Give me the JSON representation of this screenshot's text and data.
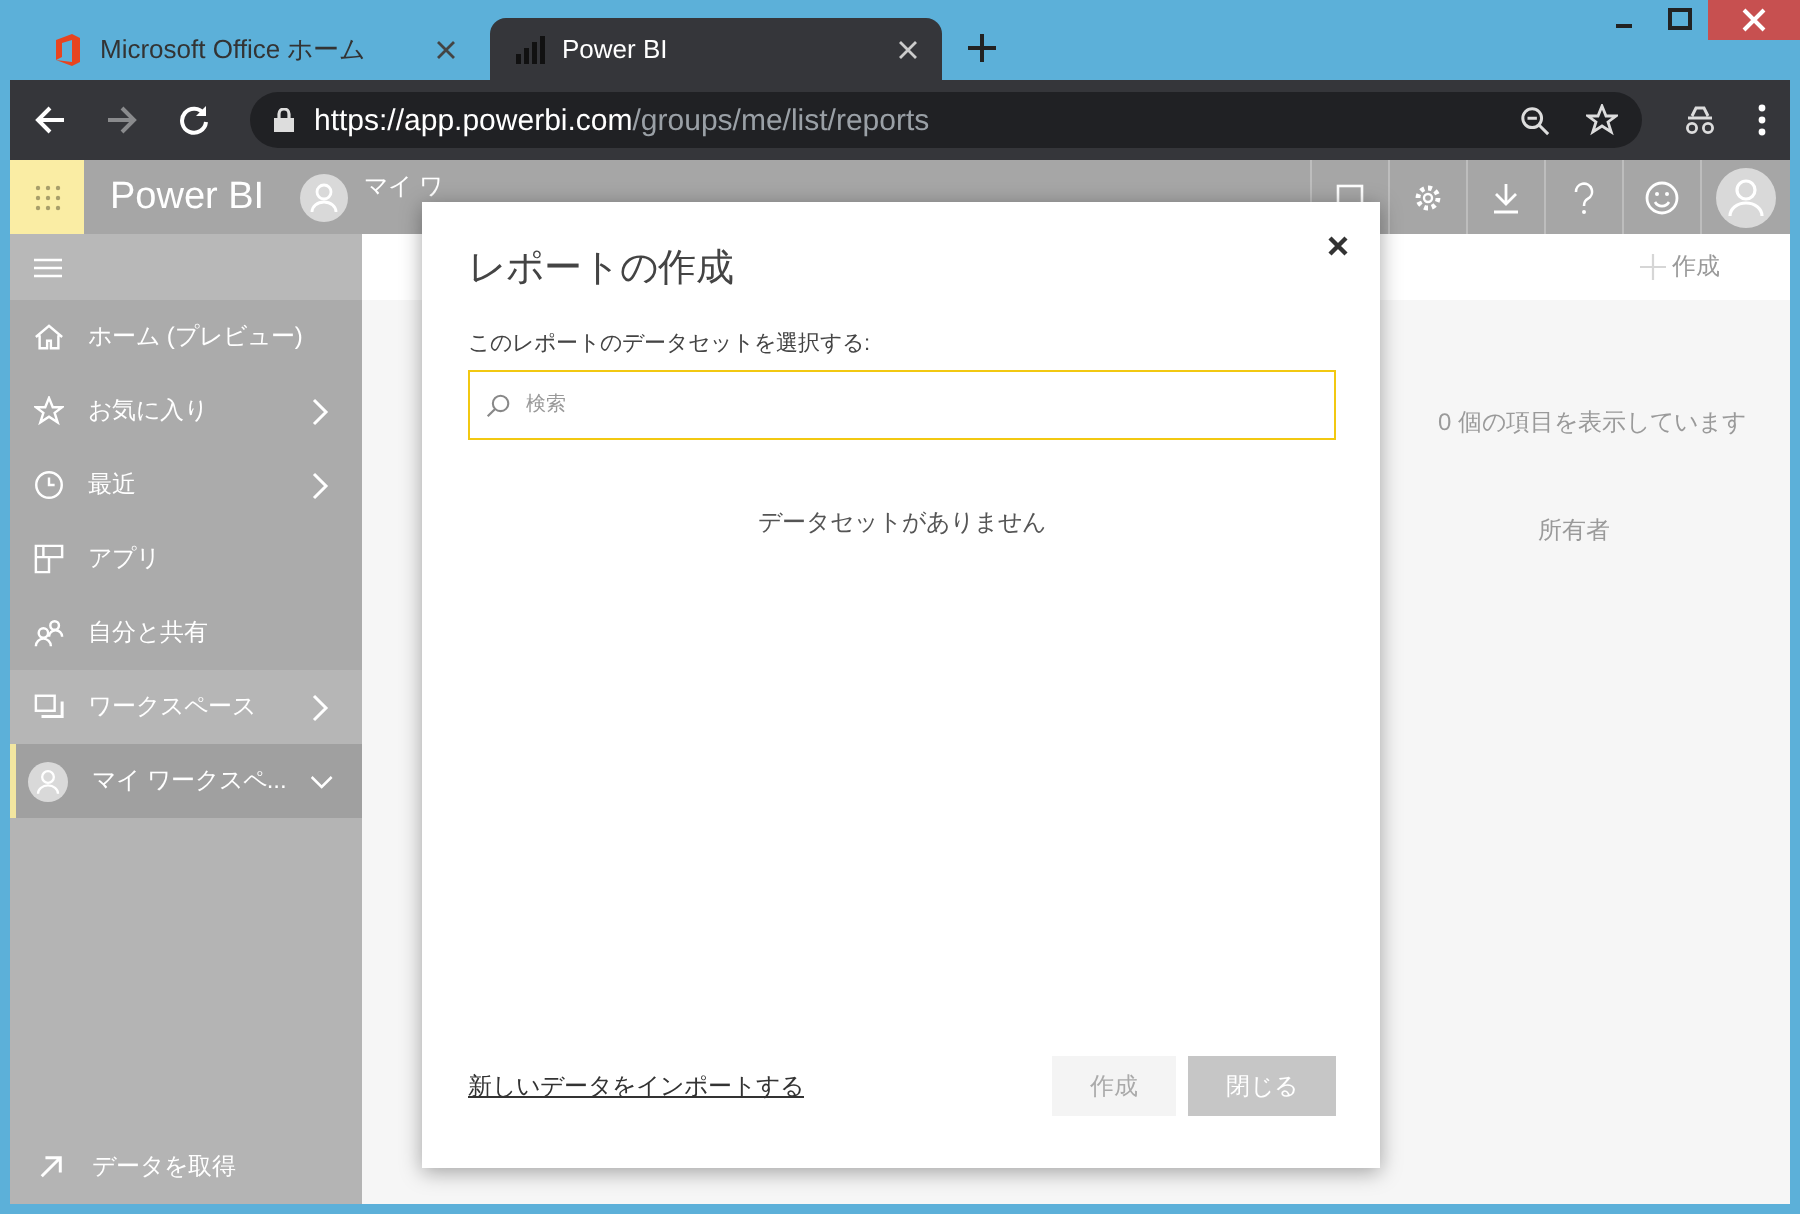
{
  "browser": {
    "tabs": [
      {
        "title": "Microsoft Office ホーム",
        "selected": false
      },
      {
        "title": "Power BI",
        "selected": true
      }
    ],
    "url": {
      "host": "https://app.powerbi.com",
      "path": "/groups/me/list/reports"
    }
  },
  "header": {
    "app_name": "Power BI",
    "workspace": "マイ ワ"
  },
  "sidebar": {
    "items": [
      {
        "label": "ホーム (プレビュー)",
        "kind": "plain",
        "selected": false
      },
      {
        "label": "お気に入り",
        "kind": "collapsed",
        "selected": false
      },
      {
        "label": "最近",
        "kind": "collapsed",
        "selected": false
      },
      {
        "label": "アプリ",
        "kind": "plain",
        "selected": false
      },
      {
        "label": "自分と共有",
        "kind": "plain",
        "selected": false
      },
      {
        "label": "ワークスペース",
        "kind": "collapsed",
        "selected": false
      },
      {
        "label": "マイ ワークスペ...",
        "kind": "expanded",
        "selected": true
      }
    ],
    "footer": "データを取得"
  },
  "content": {
    "create": "作成",
    "count": "0 個の項目を表示しています",
    "owner": "所有者"
  },
  "dialog": {
    "title": "レポートの作成",
    "prompt": "このレポートのデータセットを選択する:",
    "search": {
      "placeholder": "検索"
    },
    "empty": "データセットがありません",
    "import_link": "新しいデータをインポートする",
    "buttons": [
      {
        "label": "作成",
        "disabled": true
      },
      {
        "label": "閉じる",
        "disabled": false
      }
    ]
  }
}
